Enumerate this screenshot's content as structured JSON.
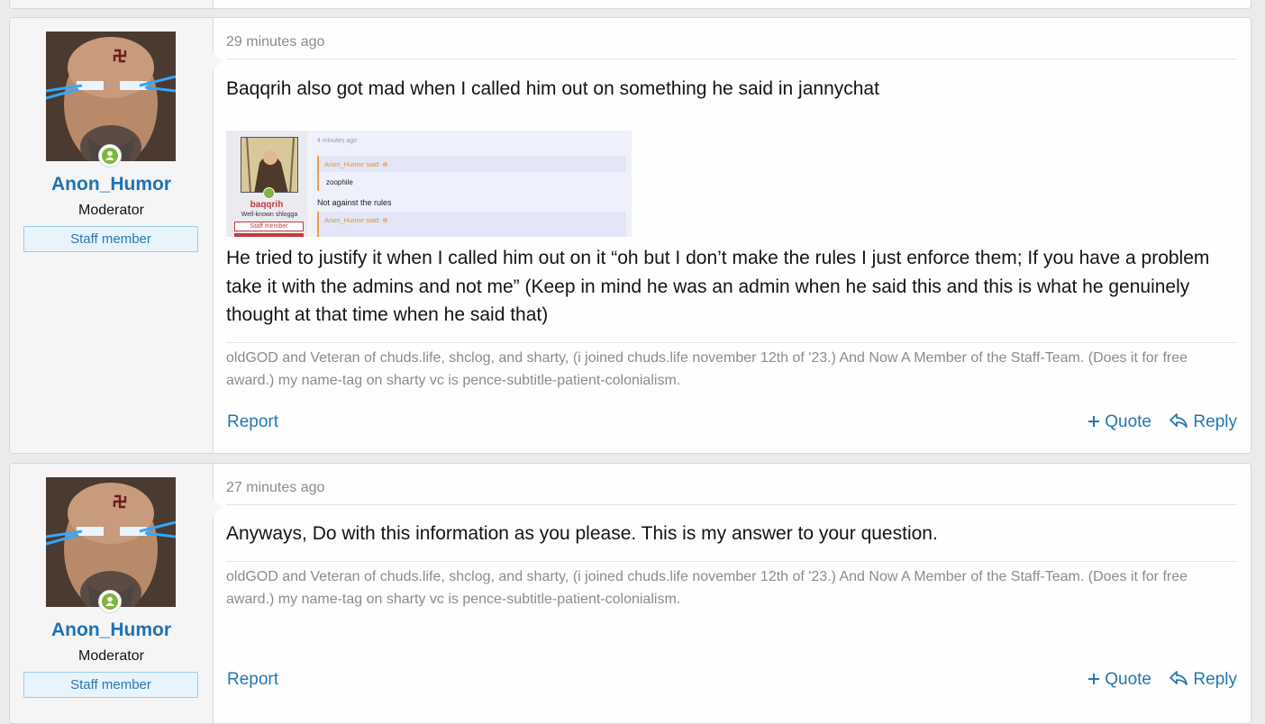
{
  "posts": [
    {
      "user": {
        "name": "Anon_Humor",
        "title": "Moderator",
        "banner": "Staff member"
      },
      "timestamp": "29 minutes ago",
      "message_lines": [
        "Baqqrih also got mad when I called him out on something he said in jannychat",
        "He tried to justify it when I called him out on it “oh but I don’t make the rules I just enforce them; If you have a problem take it with the admins and not me” (Keep in mind he was an admin when he said this and this is what he genuinely thought at that time when he said that)"
      ],
      "embedded_image": {
        "time": "4 minutes ago",
        "username": "baqqrih",
        "user_title": "Well-known shlogga",
        "staff_banner": "Staff member",
        "quote1_head": "Anon_Humor said:",
        "quote1_body": "zoophile",
        "text": "Not against the rules",
        "quote2_head": "Anon_Humor said:"
      },
      "signature": "oldGOD and Veteran of chuds.life, shclog, and sharty, (i joined chuds.life november 12th of '23.) And Now A Member of the Staff-Team. (Does it for free award.) my name-tag on sharty vc is pence-subtitle-patient-colonialism.",
      "actions": {
        "report": "Report",
        "quote": "Quote",
        "reply": "Reply"
      }
    },
    {
      "user": {
        "name": "Anon_Humor",
        "title": "Moderator",
        "banner": "Staff member"
      },
      "timestamp": "27 minutes ago",
      "message_lines": [
        "Anyways, Do with this information as you please. This is my answer to your question."
      ],
      "signature": "oldGOD and Veteran of chuds.life, shclog, and sharty, (i joined chuds.life november 12th of '23.) And Now A Member of the Staff-Team. (Does it for free award.) my name-tag on sharty vc is pence-subtitle-patient-colonialism.",
      "actions": {
        "report": "Report",
        "quote": "Quote",
        "reply": "Reply"
      }
    }
  ],
  "icons": {
    "quote": "plus-icon",
    "reply": "reply-arrow-icon",
    "online": "user-online-icon",
    "avatar_symbol": "swastika-symbol"
  },
  "colors": {
    "link": "#2577b1",
    "username": "#1d73b5",
    "staff_banner_bg": "#e8f3fb",
    "online": "#7fb43e"
  }
}
